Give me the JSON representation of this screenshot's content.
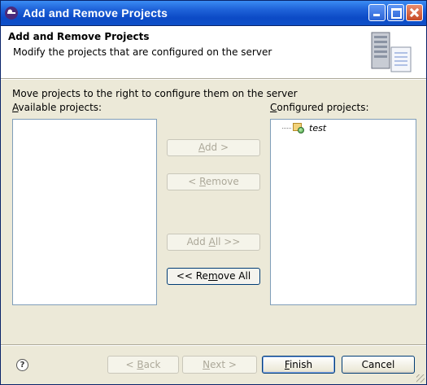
{
  "window": {
    "title": "Add and Remove Projects"
  },
  "header": {
    "title": "Add and Remove Projects",
    "description": "Modify the projects that are configured on the server"
  },
  "instruction": "Move projects to the right to configure them on the server",
  "available": {
    "label_mnemonic": "A",
    "label_rest": "vailable projects:",
    "items": []
  },
  "configured": {
    "label_mnemonic": "C",
    "label_rest": "onfigured projects:",
    "items": [
      {
        "name": "test",
        "icon": "project-icon"
      }
    ]
  },
  "buttons": {
    "add": {
      "mnemonic": "A",
      "rest": "dd >",
      "enabled": false
    },
    "remove": {
      "prefix": "< ",
      "mnemonic": "R",
      "rest": "emove",
      "enabled": false
    },
    "add_all": {
      "prefix": "Add ",
      "mnemonic": "A",
      "rest": "ll >>",
      "enabled": false
    },
    "remove_all": {
      "prefix": "<< Re",
      "mnemonic": "m",
      "rest": "ove All",
      "enabled": true
    },
    "back": {
      "prefix": "< ",
      "mnemonic": "B",
      "rest": "ack",
      "enabled": false
    },
    "next": {
      "mnemonic": "N",
      "rest": "ext >",
      "enabled": false
    },
    "finish": {
      "mnemonic": "F",
      "rest": "inish",
      "enabled": true
    },
    "cancel": {
      "label": "Cancel",
      "enabled": true
    }
  },
  "help": {
    "glyph": "?",
    "icon": "help-icon"
  }
}
